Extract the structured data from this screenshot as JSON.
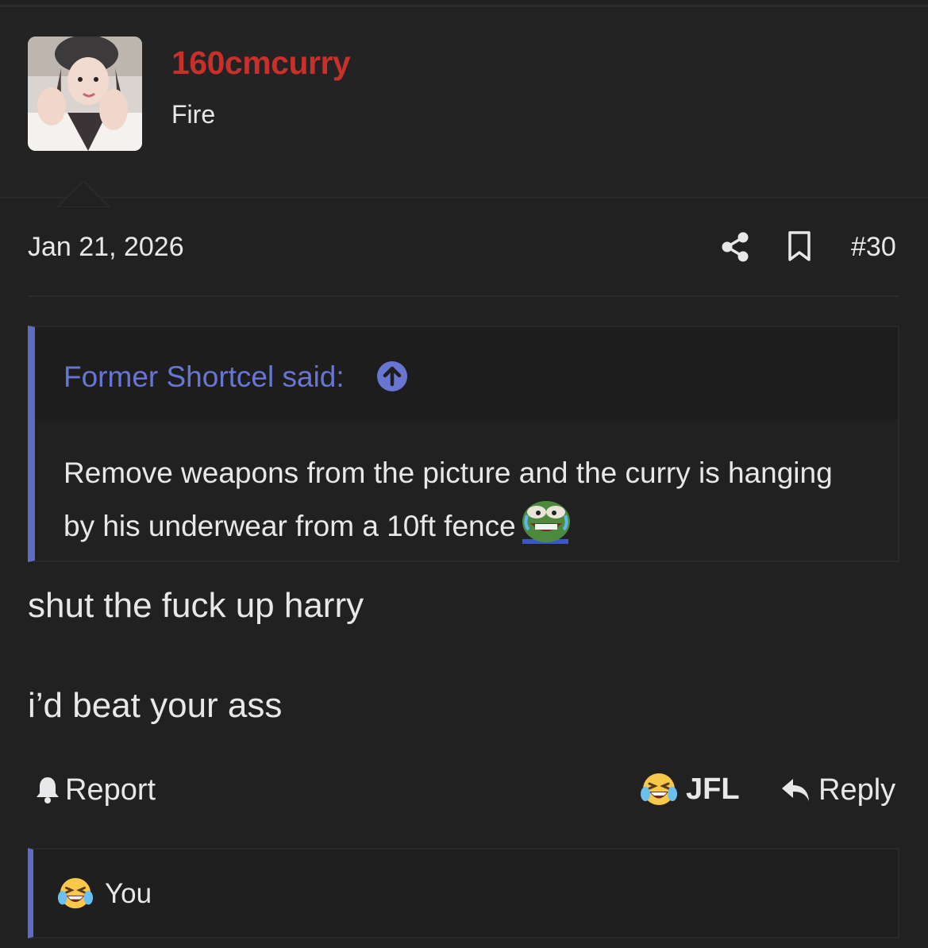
{
  "user": {
    "name": "160cmcurry",
    "title": "Fire",
    "name_color": "#c9302c"
  },
  "post": {
    "date": "Jan 21, 2026",
    "number": "#30",
    "lines": [
      "shut the fuck up harry",
      "i’d beat your ass"
    ]
  },
  "quote": {
    "author_label": "Former Shortcel said:",
    "text": "Remove weapons from the picture and the curry is hanging by his underwear from a 10ft fence",
    "emoji": "pepe-crying-laughing-icon",
    "accent": "#5f6cc2"
  },
  "actions": {
    "report": "Report",
    "reaction_label": "JFL",
    "reply": "Reply"
  },
  "reactions": {
    "users": "You",
    "emoji": "crying-laughing-emoji"
  },
  "colors": {
    "background": "#212122",
    "quote_link": "#6876d2"
  }
}
